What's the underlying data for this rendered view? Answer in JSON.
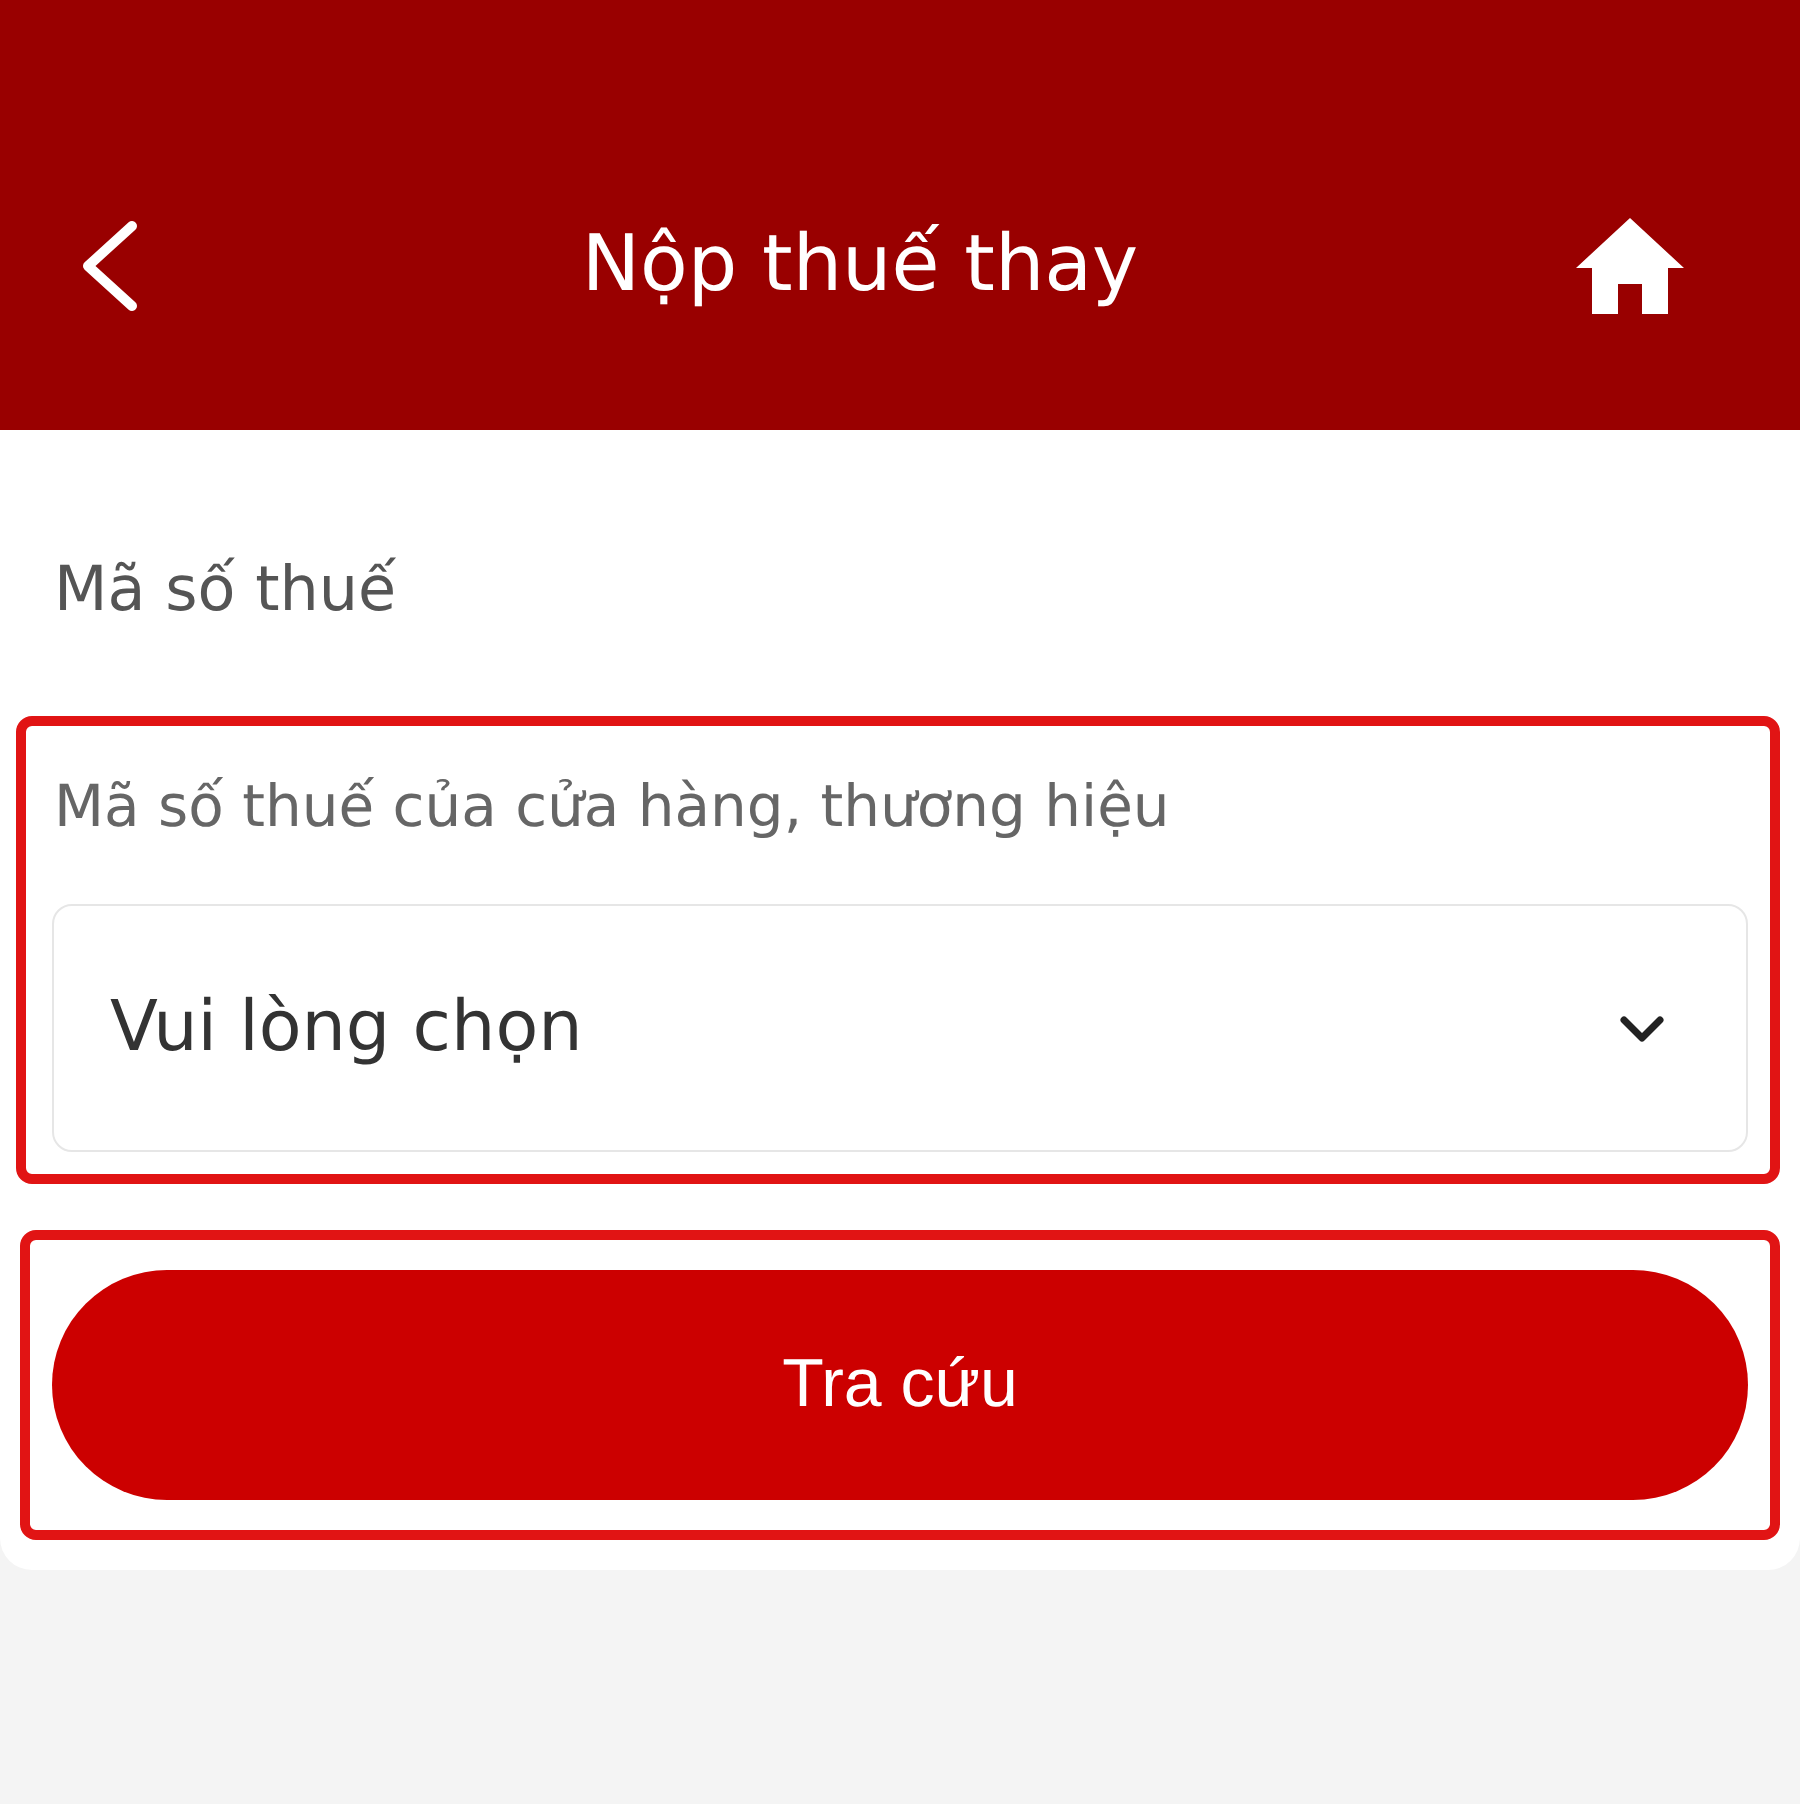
{
  "header": {
    "title": "Nộp thuế thay"
  },
  "form": {
    "section_label": "Mã số thuế",
    "field": {
      "label": "Mã số thuế của cửa hàng, thương hiệu",
      "placeholder": "Vui lòng chọn",
      "highlighted": true
    }
  },
  "buttons": [
    {
      "label": "Tra cứu",
      "highlighted": true
    }
  ]
}
